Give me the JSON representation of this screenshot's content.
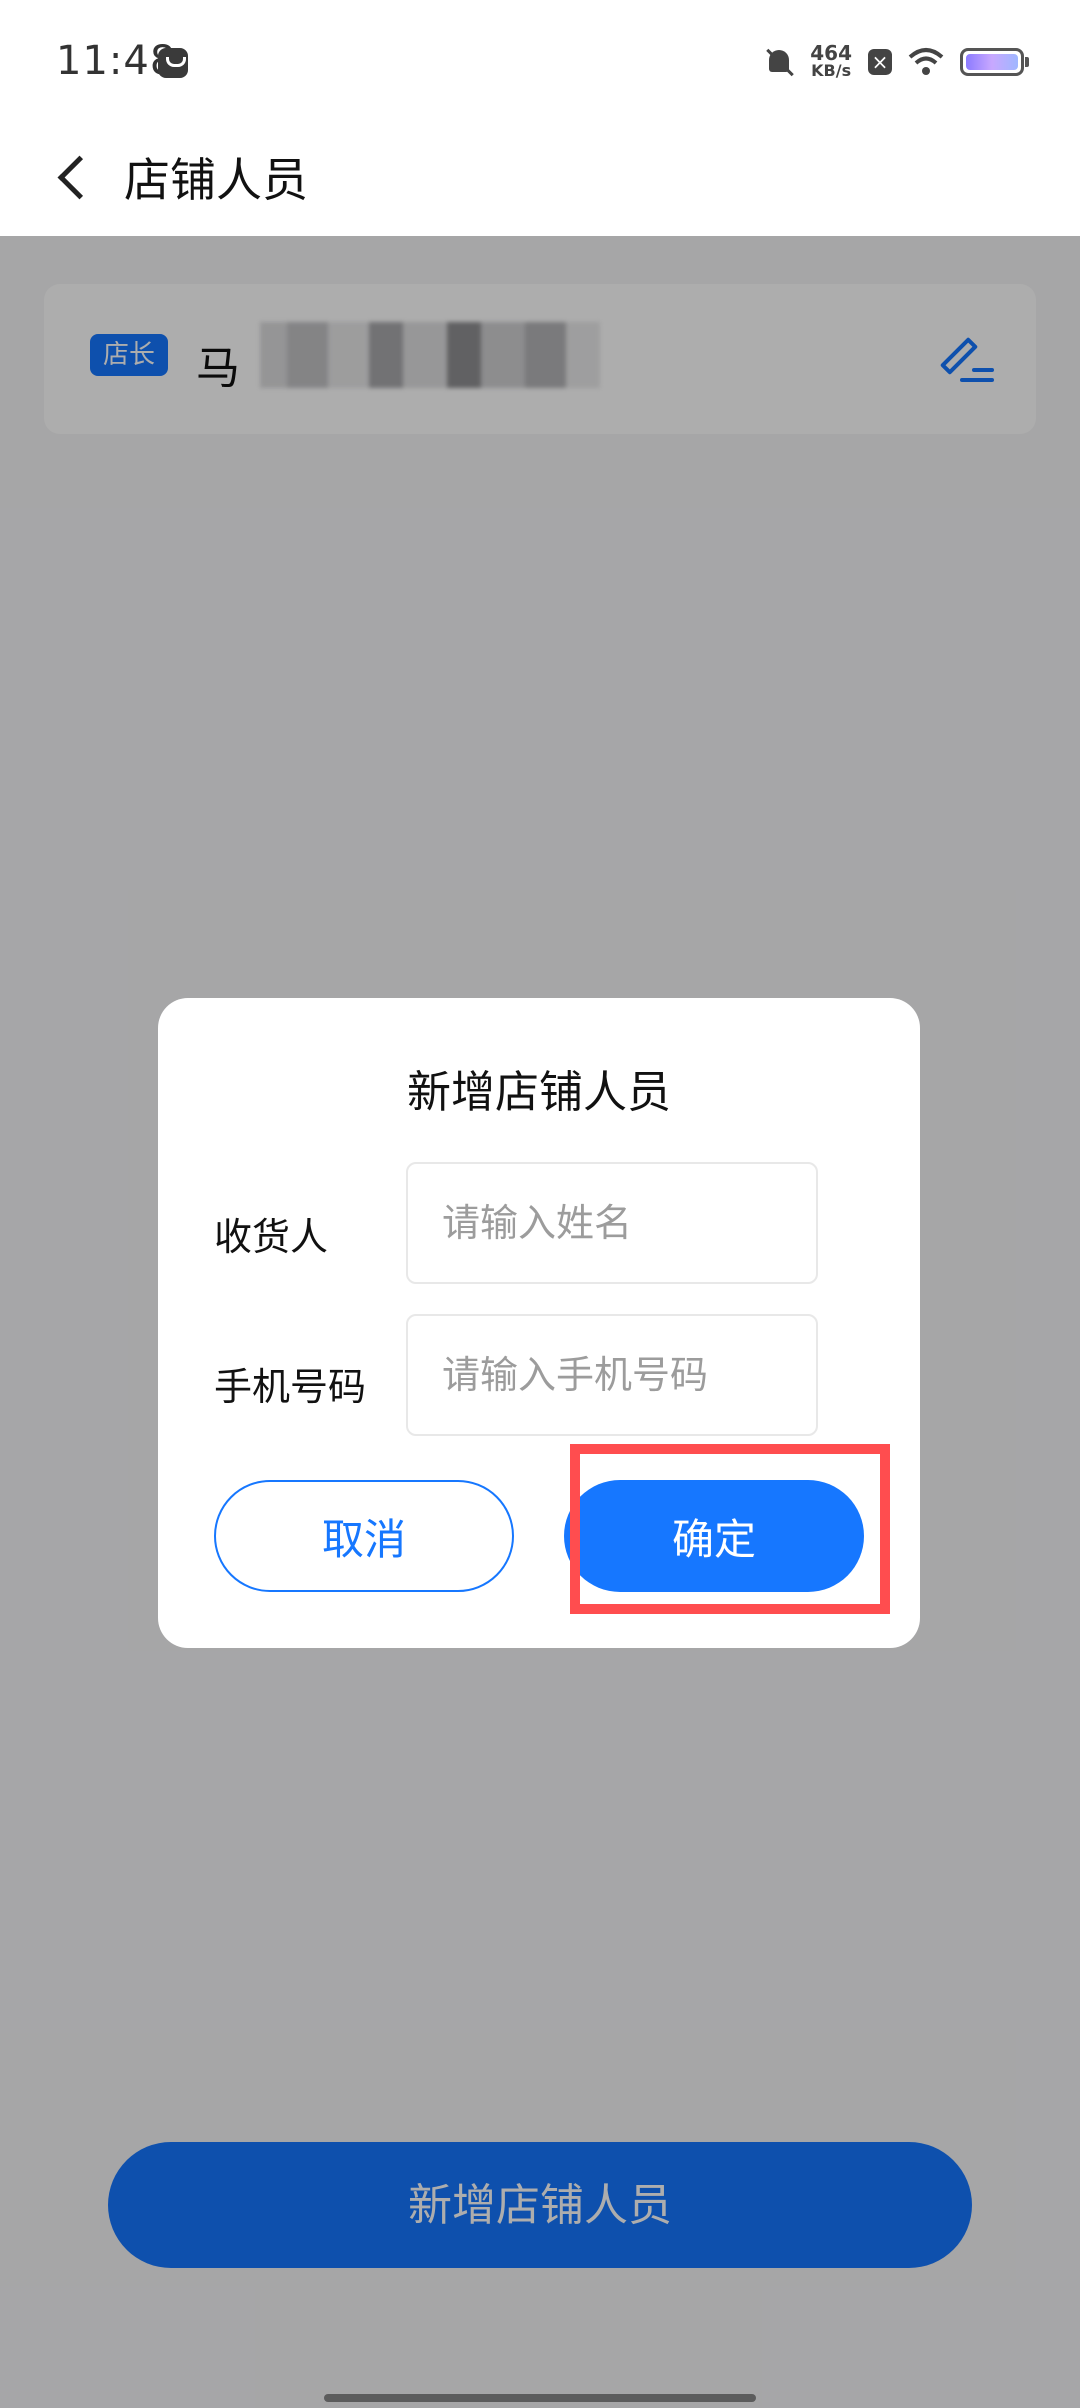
{
  "status_bar": {
    "time": "11:48",
    "net_speed_value": "464",
    "net_speed_unit": "KB/s"
  },
  "header": {
    "title": "店铺人员"
  },
  "member_list": [
    {
      "role": "店长",
      "name": "马"
    }
  ],
  "bottom_button_label": "新增店铺人员",
  "dialog": {
    "title": "新增店铺人员",
    "fields": [
      {
        "label": "收货人",
        "placeholder": "请输入姓名",
        "value": ""
      },
      {
        "label": "手机号码",
        "placeholder": "请输入手机号码",
        "value": ""
      }
    ],
    "cancel_label": "取消",
    "confirm_label": "确定"
  },
  "colors": {
    "accent": "#1677ff",
    "highlight": "#ff4d4f"
  }
}
